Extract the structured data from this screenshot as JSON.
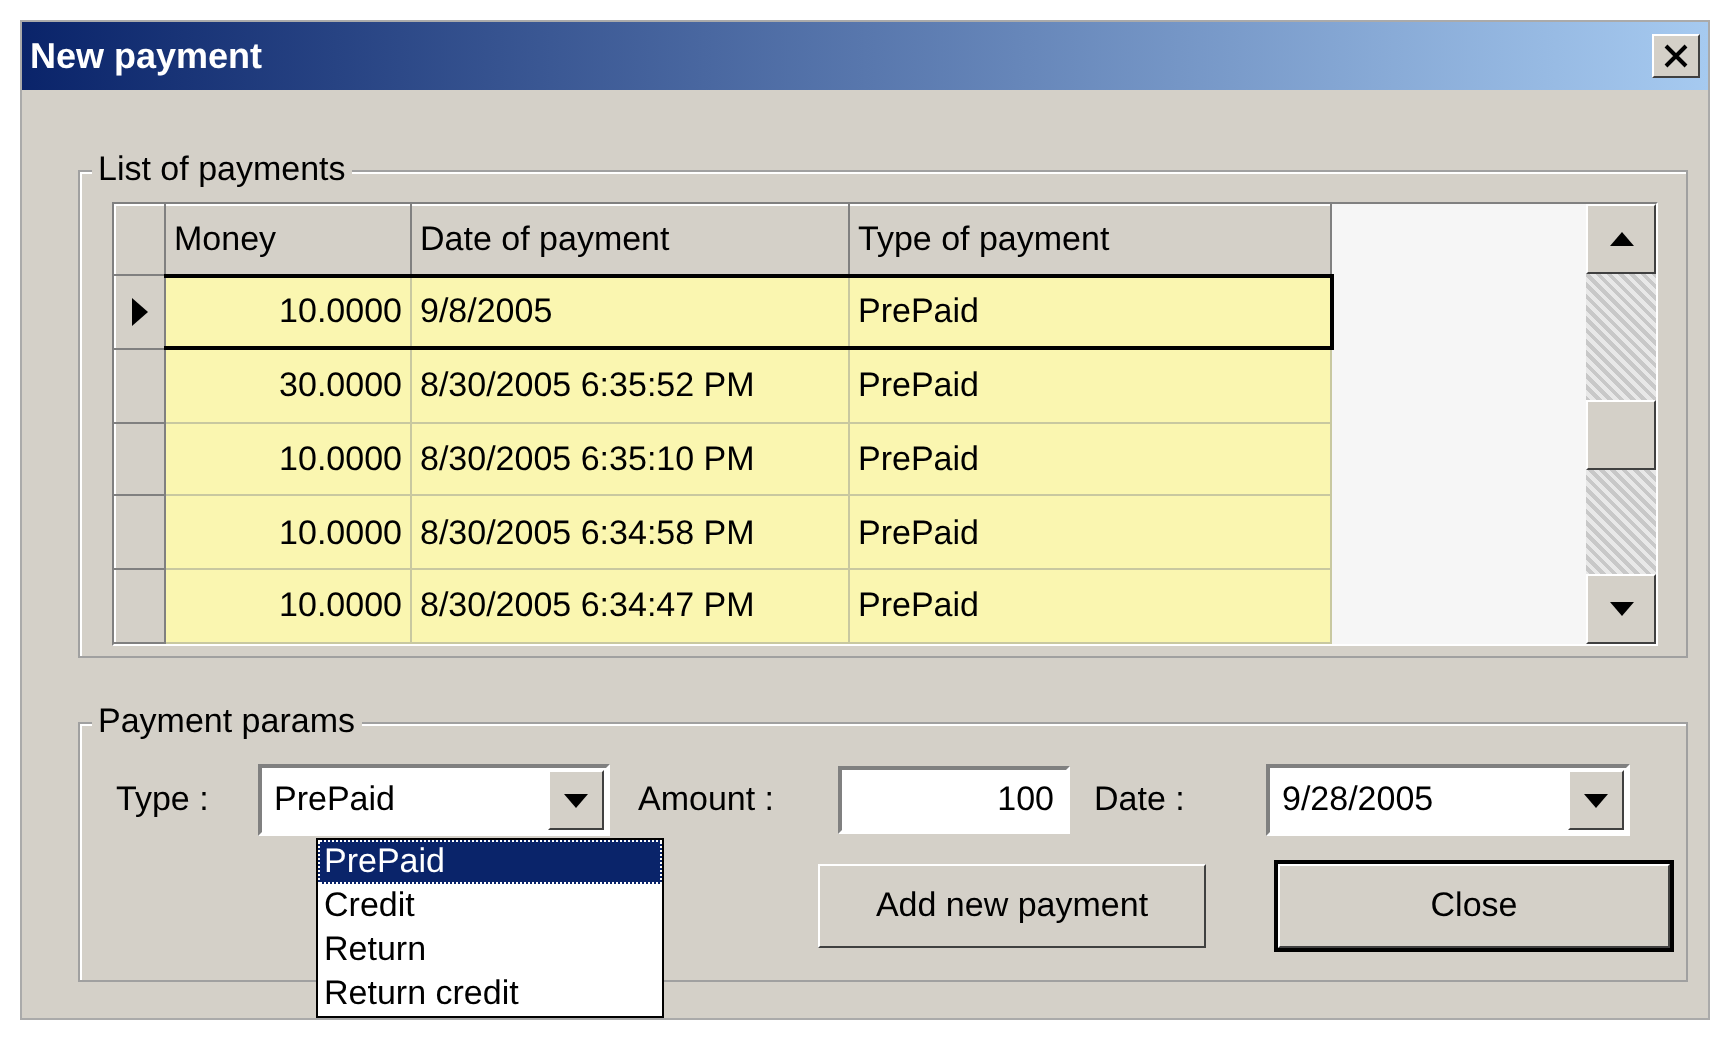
{
  "window": {
    "title": "New payment"
  },
  "payments": {
    "title": "List of payments",
    "columns": [
      "Money",
      "Date of payment",
      "Type of payment"
    ],
    "rows": [
      {
        "money": "10.0000",
        "date": "9/8/2005",
        "type": "PrePaid",
        "selected": true
      },
      {
        "money": "30.0000",
        "date": "8/30/2005 6:35:52 PM",
        "type": "PrePaid",
        "selected": false
      },
      {
        "money": "10.0000",
        "date": "8/30/2005 6:35:10 PM",
        "type": "PrePaid",
        "selected": false
      },
      {
        "money": "10.0000",
        "date": "8/30/2005 6:34:58 PM",
        "type": "PrePaid",
        "selected": false
      },
      {
        "money": "10.0000",
        "date": "8/30/2005 6:34:47 PM",
        "type": "PrePaid",
        "selected": false
      }
    ]
  },
  "params": {
    "title": "Payment params",
    "type_label": "Type :",
    "type_value": "PrePaid",
    "type_options": [
      {
        "label": "PrePaid",
        "selected": true
      },
      {
        "label": "Credit",
        "selected": false
      },
      {
        "label": "Return",
        "selected": false
      },
      {
        "label": "Return credit",
        "selected": false
      }
    ],
    "amount_label": "Amount :",
    "amount_value": "100",
    "date_label": "Date :",
    "date_value": "9/28/2005",
    "buttons": [
      {
        "label": "Add new payment",
        "default": false
      },
      {
        "label": "Close",
        "default": true
      }
    ]
  }
}
